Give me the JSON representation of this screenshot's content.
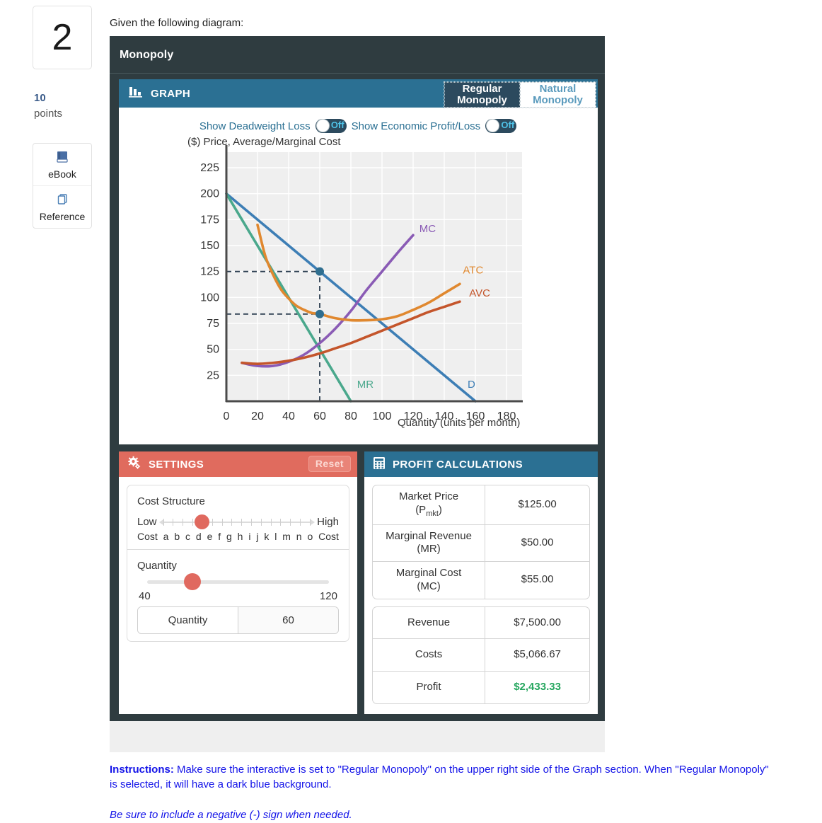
{
  "sidebar": {
    "question_number": "2",
    "points_value": "10",
    "points_label": "points",
    "tools": [
      {
        "label": "eBook",
        "icon": "book-icon"
      },
      {
        "label": "Reference",
        "icon": "copy-icon"
      }
    ]
  },
  "prompt": "Given the following diagram:",
  "widget": {
    "title": "Monopoly",
    "graph_header": "GRAPH",
    "mode_buttons": [
      {
        "label": "Regular Monopoly",
        "selected": true
      },
      {
        "label": "Natural Monopoly",
        "selected": false
      }
    ],
    "toggles": [
      {
        "label": "Show Deadweight Loss",
        "state": "Off"
      },
      {
        "label": "Show Economic Profit/Loss",
        "state": "Off"
      }
    ]
  },
  "chart_data": {
    "type": "line",
    "title": "",
    "ylabel": "($) Price, Average/Marginal Cost",
    "xlabel": "Quantity (units per month)",
    "xlim": [
      0,
      190
    ],
    "ylim": [
      0,
      240
    ],
    "xticks": [
      0,
      20,
      40,
      60,
      80,
      100,
      120,
      140,
      160,
      180
    ],
    "yticks": [
      25,
      50,
      75,
      100,
      125,
      150,
      175,
      200,
      225
    ],
    "grid": true,
    "legend": "inline-labels",
    "series": [
      {
        "name": "D",
        "label": "D",
        "color": "#3d7eb5",
        "points": [
          [
            0,
            200
          ],
          [
            160,
            0
          ]
        ]
      },
      {
        "name": "MR",
        "label": "MR",
        "color": "#4aa88c",
        "points": [
          [
            0,
            200
          ],
          [
            80,
            0
          ]
        ]
      },
      {
        "name": "MC",
        "label": "MC",
        "color": "#8a5bb5",
        "points": [
          [
            10,
            37
          ],
          [
            20,
            34
          ],
          [
            30,
            34
          ],
          [
            40,
            38
          ],
          [
            50,
            45
          ],
          [
            60,
            56
          ],
          [
            70,
            70
          ],
          [
            80,
            87
          ],
          [
            90,
            107
          ],
          [
            100,
            125
          ],
          [
            110,
            143
          ],
          [
            120,
            160
          ]
        ]
      },
      {
        "name": "ATC",
        "label": "ATC",
        "color": "#e0882f",
        "points": [
          [
            20,
            170
          ],
          [
            25,
            140
          ],
          [
            30,
            122
          ],
          [
            35,
            108
          ],
          [
            40,
            99
          ],
          [
            45,
            92
          ],
          [
            50,
            88
          ],
          [
            55,
            85
          ],
          [
            60,
            84
          ],
          [
            70,
            80
          ],
          [
            80,
            78
          ],
          [
            90,
            78
          ],
          [
            100,
            79
          ],
          [
            110,
            82
          ],
          [
            120,
            88
          ],
          [
            130,
            95
          ],
          [
            140,
            104
          ],
          [
            150,
            113
          ]
        ]
      },
      {
        "name": "AVC",
        "label": "AVC",
        "color": "#c4552b",
        "points": [
          [
            10,
            37
          ],
          [
            20,
            36
          ],
          [
            30,
            37
          ],
          [
            40,
            39
          ],
          [
            50,
            42
          ],
          [
            60,
            46
          ],
          [
            70,
            51
          ],
          [
            80,
            56
          ],
          [
            90,
            62
          ],
          [
            100,
            68
          ],
          [
            110,
            74
          ],
          [
            120,
            80
          ],
          [
            130,
            86
          ],
          [
            140,
            91
          ],
          [
            150,
            96
          ]
        ]
      }
    ],
    "markers": [
      {
        "x": 60,
        "y": 125,
        "on": "D",
        "color": "#2f6e8f"
      },
      {
        "x": 60,
        "y": 84,
        "on": "ATC",
        "color": "#2f6e8f"
      }
    ],
    "guides": [
      {
        "type": "hline",
        "y": 125,
        "from_x": 0,
        "to_x": 60
      },
      {
        "type": "hline",
        "y": 84,
        "from_x": 0,
        "to_x": 60
      },
      {
        "type": "vline",
        "x": 60,
        "from_y": 0,
        "to_y": 125
      }
    ]
  },
  "settings": {
    "header": "SETTINGS",
    "reset_label": "Reset",
    "cost_structure": {
      "title": "Cost Structure",
      "low_label": "Low",
      "low_sub": "Cost",
      "high_label": "High",
      "high_sub": "Cost",
      "tick_letters": [
        "a",
        "b",
        "c",
        "d",
        "e",
        "f",
        "g",
        "h",
        "i",
        "j",
        "k",
        "l",
        "m",
        "n",
        "o"
      ],
      "value_index": 4,
      "thumb_percent": 26
    },
    "quantity": {
      "title": "Quantity",
      "min_label": "40",
      "max_label": "120",
      "field_label": "Quantity",
      "value": "60",
      "thumb_percent": 25
    }
  },
  "profit": {
    "header": "PROFIT CALCULATIONS",
    "table_top": [
      {
        "key_line1": "Market Price",
        "key_line2": "(P",
        "key_sub": "mkt",
        "key_line3": ")",
        "value": "$125.00"
      },
      {
        "key_line1": "Marginal Revenue",
        "key_line2": "(MR)",
        "value": "$50.00"
      },
      {
        "key_line1": "Marginal Cost",
        "key_line2": "(MC)",
        "value": "$55.00"
      }
    ],
    "table_bottom": [
      {
        "key": "Revenue",
        "value": "$7,500.00",
        "positive": false
      },
      {
        "key": "Costs",
        "value": "$5,066.67",
        "positive": false
      },
      {
        "key": "Profit",
        "value": "$2,433.33",
        "positive": true
      }
    ]
  },
  "instructions": {
    "bold_lead": "Instructions:",
    "body": " Make sure the interactive is set to \"Regular Monopoly\" on the upper right side of the Graph section. When \"Regular Monopoly\" is selected, it will have a dark blue background.",
    "note": "Be sure to include a negative (-) sign when needed."
  },
  "colors": {
    "graph_header": "#2b7093",
    "settings_header": "#e06b5e",
    "widget_shell": "#2f3c40",
    "profit_positive": "#27a760",
    "instruction_blue": "#1414e8"
  }
}
